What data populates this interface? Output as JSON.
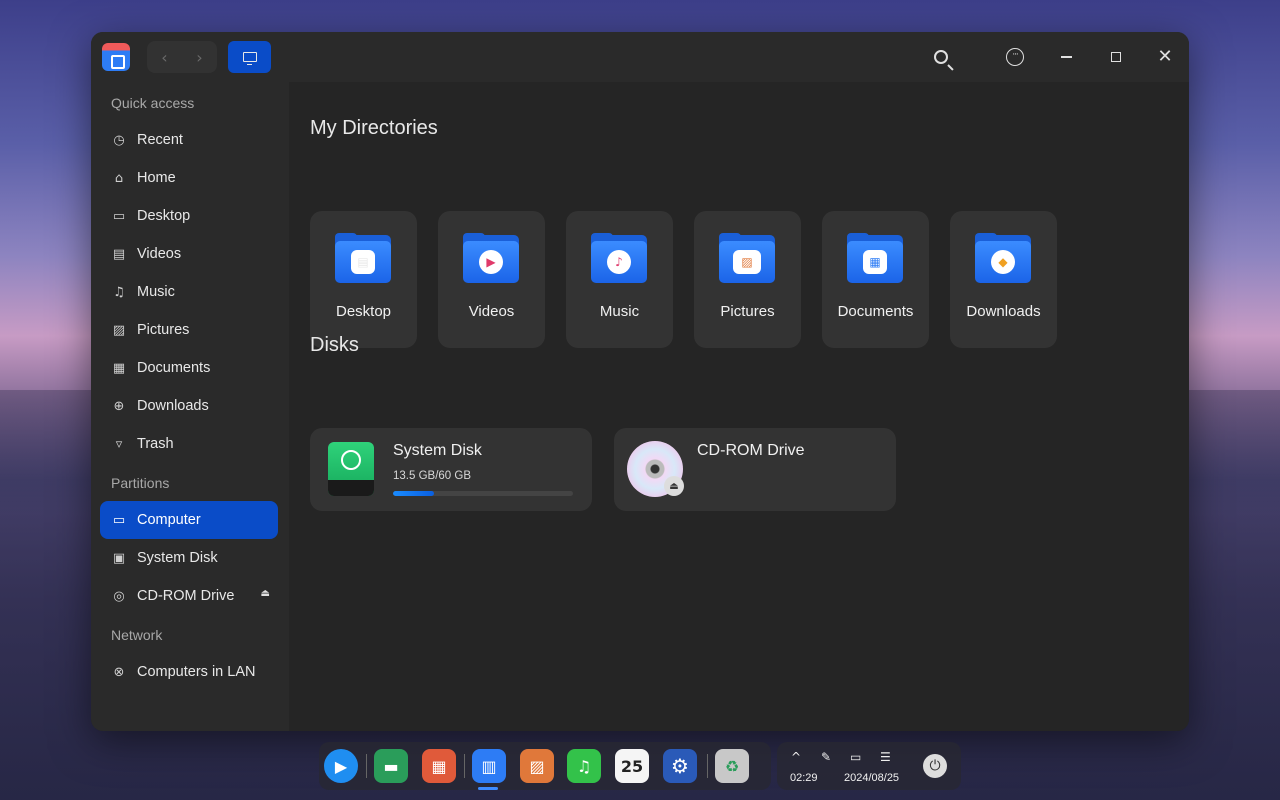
{
  "titlebar": {
    "back_icon": "chevron-left-icon",
    "forward_icon": "chevron-right-icon",
    "back_glyph": "‹",
    "forward_glyph": "›",
    "close_glyph": "✕",
    "menu_glyph": "···"
  },
  "sidebar": {
    "sections": {
      "quick_access": "Quick access",
      "partitions": "Partitions",
      "network": "Network"
    },
    "items": [
      {
        "label": "Recent",
        "glyph": "◷"
      },
      {
        "label": "Home",
        "glyph": "⌂"
      },
      {
        "label": "Desktop",
        "glyph": "▭"
      },
      {
        "label": "Videos",
        "glyph": "▤"
      },
      {
        "label": "Music",
        "glyph": "♫"
      },
      {
        "label": "Pictures",
        "glyph": "▨"
      },
      {
        "label": "Documents",
        "glyph": "▦"
      },
      {
        "label": "Downloads",
        "glyph": "⊕"
      },
      {
        "label": "Trash",
        "glyph": "▿"
      }
    ],
    "partitions": [
      {
        "label": "Computer",
        "glyph": "▭",
        "active": true
      },
      {
        "label": "System Disk",
        "glyph": "▣"
      },
      {
        "label": "CD-ROM Drive",
        "glyph": "◎",
        "eject_glyph": "⏏"
      }
    ],
    "network": [
      {
        "label": "Computers in LAN",
        "glyph": "⊗"
      }
    ]
  },
  "main": {
    "directories_title": "My Directories",
    "directories": [
      {
        "label": "Desktop",
        "glyph": "▤"
      },
      {
        "label": "Videos",
        "glyph": "▶"
      },
      {
        "label": "Music",
        "glyph": "♪"
      },
      {
        "label": "Pictures",
        "glyph": "▨"
      },
      {
        "label": "Documents",
        "glyph": "▦"
      },
      {
        "label": "Downloads",
        "glyph": "◆"
      }
    ],
    "disks_title": "Disks",
    "disks": [
      {
        "label": "System Disk",
        "usage": "13.5 GB/60 GB",
        "fill_fraction": 0.225
      },
      {
        "label": "CD-ROM Drive",
        "eject_glyph": "⏏"
      }
    ]
  },
  "taskbar": {
    "apps": [
      {
        "name": "launcher",
        "glyph": "▶",
        "color": "#1f8ef1"
      },
      {
        "name": "terminal",
        "glyph": "▬",
        "color": "#2a9d5a"
      },
      {
        "name": "app-store",
        "glyph": "▦",
        "color": "#e05a3a"
      },
      {
        "name": "file-manager",
        "glyph": "▥",
        "color": "#2d7cf5"
      },
      {
        "name": "image-viewer",
        "glyph": "▨",
        "color": "#e0783a"
      },
      {
        "name": "music",
        "glyph": "♫",
        "color": "#33c24a"
      },
      {
        "name": "calendar",
        "glyph": "25",
        "color": "#f5f5f5"
      },
      {
        "name": "settings",
        "glyph": "⚙",
        "color": "#2a5ab8"
      },
      {
        "name": "trash",
        "glyph": "♻",
        "color": "#c8c8c8"
      }
    ],
    "time": "02:29",
    "date": "2024/08/25",
    "tray_up_glyph": "^",
    "tray_pen_glyph": "✎",
    "tray_battery_glyph": "▭",
    "tray_toggle_glyph": "☰",
    "power_glyph": "⏻"
  }
}
